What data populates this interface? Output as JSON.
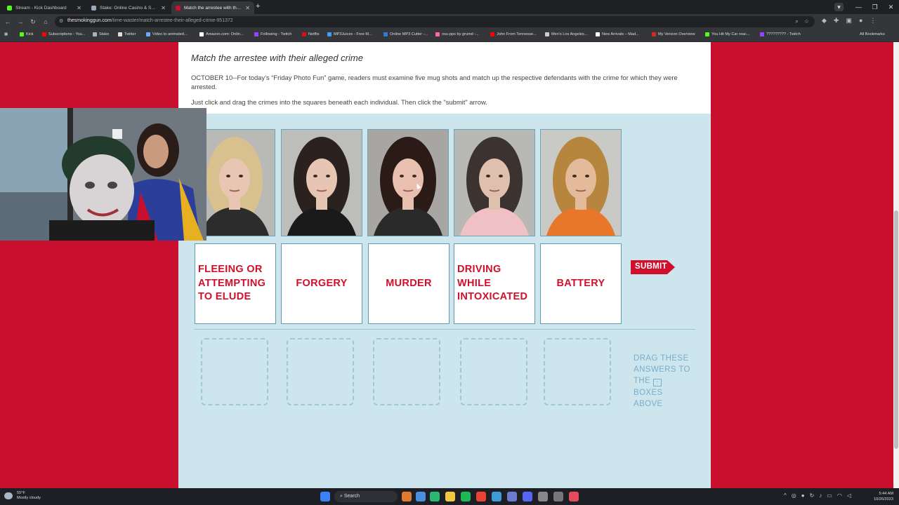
{
  "browser": {
    "tabs": [
      {
        "title": "Stream - Kick Dashboard",
        "fav_color": "#53fc18",
        "active": false
      },
      {
        "title": "Stake: Online Casino & Sports",
        "fav_color": "#9aa8b8",
        "active": false
      },
      {
        "title": "Match the arrestee with their al",
        "fav_color": "#d0102a",
        "active": true
      }
    ],
    "new_tab": "+",
    "url_host": "thesmokinggun.com",
    "url_path": "/time-waster/match-arrestee-their-alleged-crime-951372",
    "bookmarks": [
      {
        "label": "Kick",
        "color": "#53fc18"
      },
      {
        "label": "Subscriptions - You...",
        "color": "#ff0000"
      },
      {
        "label": "Stake",
        "color": "#aab4c0"
      },
      {
        "label": "Twitter",
        "color": "#dddddd"
      },
      {
        "label": "Video to animated...",
        "color": "#6aa9ff"
      },
      {
        "label": "Amazon.com: Onlin...",
        "color": "#ffffff"
      },
      {
        "label": "Following - Twitch",
        "color": "#9146ff"
      },
      {
        "label": "Netflix",
        "color": "#e50914"
      },
      {
        "label": "MP3Juices - Free M...",
        "color": "#3aa0ff"
      },
      {
        "label": "Online MP3 Cutter -...",
        "color": "#2f7bd6"
      },
      {
        "label": "osu-pps by grumd -...",
        "color": "#ff66aa"
      },
      {
        "label": "John From Tennesse...",
        "color": "#ff0000"
      },
      {
        "label": "Men's Los Angeles...",
        "color": "#cccccc"
      },
      {
        "label": "New Arrivals – Mad...",
        "color": "#ffffff"
      },
      {
        "label": "My Verizon Overview",
        "color": "#d52b1e"
      },
      {
        "label": "You Hit My Car reac...",
        "color": "#53fc18"
      },
      {
        "label": "????????? - Twitch",
        "color": "#9146ff"
      }
    ],
    "all_bookmarks": "All Bookmarks"
  },
  "article": {
    "heading": "Match the arrestee with their alleged crime",
    "paragraph": "OCTOBER 10--For today’s “Friday Photo Fun” game, readers must examine five mug shots and match up the respective defendants with the crime for which they were arrested.",
    "instructions": "Just click and drag the crimes into the squares beneath each individual. Then click the \"submit\" arrow."
  },
  "game": {
    "mugshots": [
      {
        "name": "mugshot-1",
        "hair": "#d9c08f",
        "bg": "#b9b9b6",
        "shirt": "#2c2c2c",
        "skin": "#e8c6b3"
      },
      {
        "name": "mugshot-2",
        "hair": "#2b2220",
        "bg": "#bdbdbb",
        "shirt": "#1a1a1a",
        "skin": "#e6c5b2"
      },
      {
        "name": "mugshot-3",
        "hair": "#2a1b16",
        "bg": "#a7a6a3",
        "shirt": "#2a2a2a",
        "skin": "#e9c0b0"
      },
      {
        "name": "mugshot-4",
        "hair": "#3c3330",
        "bg": "#b8b8b5",
        "shirt": "#efc1c4",
        "skin": "#dfbfae"
      },
      {
        "name": "mugshot-5",
        "hair": "#b7863e",
        "bg": "#c9c9c5",
        "shirt": "#e9772b",
        "skin": "#e3ba9a"
      }
    ],
    "crimes": [
      {
        "label": "FLEEING OR ATTEMPTING TO ELUDE",
        "lines": [
          "FLEEING OR",
          "ATTEMPTING",
          "TO ELUDE"
        ]
      },
      {
        "label": "FORGERY",
        "lines": [
          "FORGERY"
        ]
      },
      {
        "label": "MURDER",
        "lines": [
          "MURDER"
        ]
      },
      {
        "label": "DRIVING WHILE INTOXICATED",
        "lines": [
          "DRIVING",
          "WHILE",
          "INTOXICATED"
        ]
      },
      {
        "label": "BATTERY",
        "lines": [
          "BATTERY"
        ]
      }
    ],
    "submit_label": "SUBMIT",
    "drag_hint_lines": [
      "DRAG THESE",
      "ANSWERS TO",
      "THE",
      "BOXES",
      "ABOVE"
    ],
    "accent_color": "#d0102a",
    "panel_color": "#cde5ec"
  },
  "taskbar": {
    "weather_temp": "55°F",
    "weather_desc": "Mostly cloudy",
    "search_label": "Search",
    "time": "5:44 AM",
    "date": "10/26/2023"
  }
}
